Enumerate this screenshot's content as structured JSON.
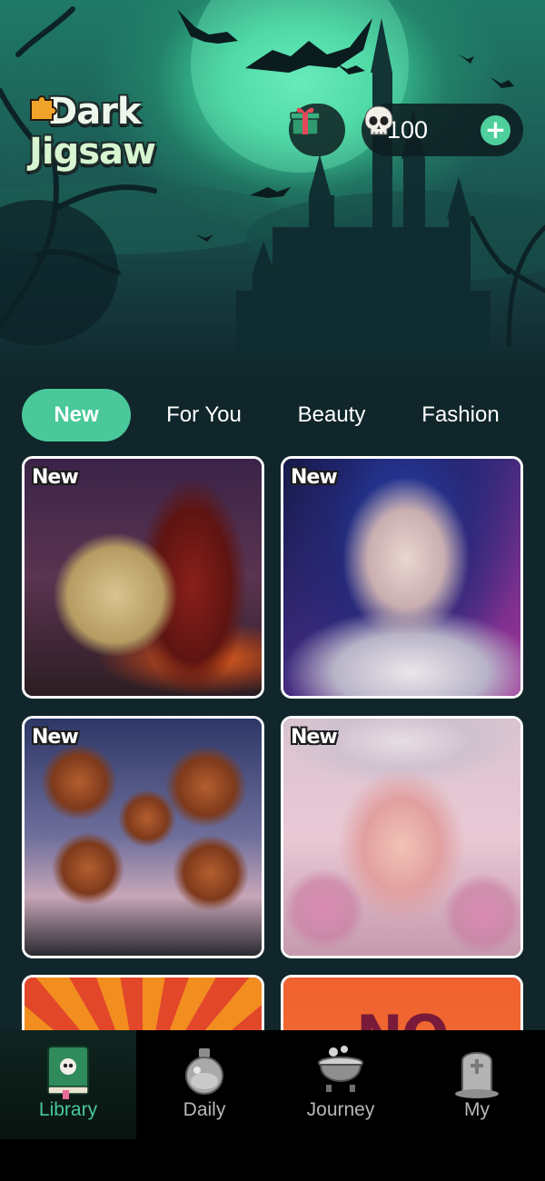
{
  "app": {
    "logo_line1": "Dark",
    "logo_line2": "Jigsaw"
  },
  "header": {
    "gift_icon": "gift-icon",
    "currency_icon": "skull-icon",
    "coin_count": "100",
    "add_label": "+"
  },
  "tabs": [
    {
      "label": "New",
      "active": true
    },
    {
      "label": "For You",
      "active": false
    },
    {
      "label": "Beauty",
      "active": false
    },
    {
      "label": "Fashion",
      "active": false
    }
  ],
  "puzzles": [
    {
      "badge": "New",
      "subject": "skull and hooded figure"
    },
    {
      "badge": "New",
      "subject": "blindfolded woman"
    },
    {
      "badge": "New",
      "subject": "eye flowers"
    },
    {
      "badge": "New",
      "subject": "pink owls and queen"
    },
    {
      "badge": "",
      "subject": "monsters"
    },
    {
      "badge": "",
      "subject": "orange poster",
      "poster_text": "NO"
    }
  ],
  "bottom_nav": [
    {
      "label": "Library",
      "icon": "book-icon",
      "active": true
    },
    {
      "label": "Daily",
      "icon": "potion-icon",
      "active": false
    },
    {
      "label": "Journey",
      "icon": "cauldron-icon",
      "active": false
    },
    {
      "label": "My",
      "icon": "tombstone-icon",
      "active": false
    }
  ],
  "colors": {
    "accent": "#4ac89a",
    "background": "#10262b",
    "nav_background": "#000000",
    "active_nav_label": "#4ac89a"
  }
}
